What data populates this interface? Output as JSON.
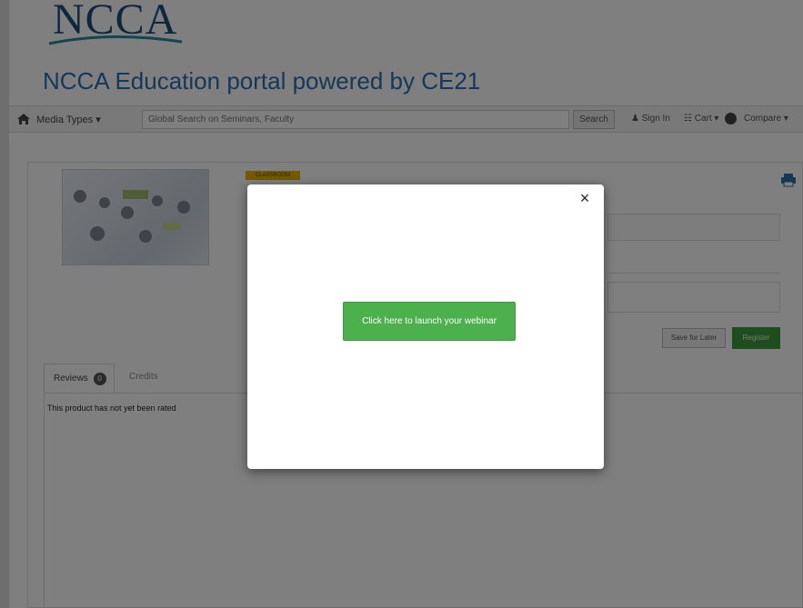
{
  "header": {
    "logo_text": "NCCA",
    "portal_title": "NCCA Education portal powered by CE21"
  },
  "navbar": {
    "media_types_label": "Media Types ▾",
    "search_placeholder": "Global Search on Seminars, Faculty",
    "search_button": "Search",
    "sign_in": "Sign In",
    "cart": "Cart ▾",
    "compare": "Compare ▾"
  },
  "product": {
    "badge": "CLASSROOM",
    "save_later_button": "Save for Later",
    "register_button": "Register"
  },
  "tabs": {
    "reviews_label": "Reviews",
    "reviews_count": "0",
    "credits_label": "Credits"
  },
  "reviews": {
    "empty_text": "This product has not yet been rated"
  },
  "modal": {
    "close_glyph": "×",
    "launch_button": "Click here to launch your webinar"
  }
}
